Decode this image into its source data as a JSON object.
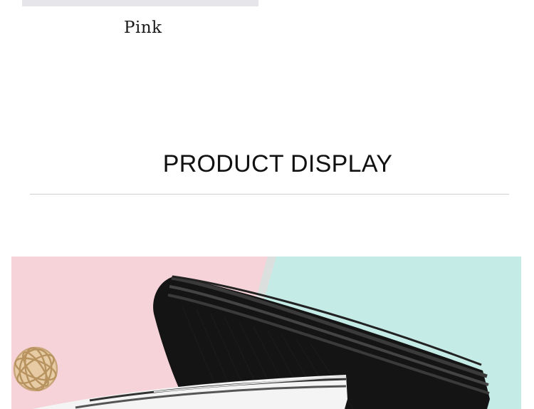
{
  "previous_variant": {
    "caption": "Pink"
  },
  "section": {
    "title": "PRODUCT DISPLAY"
  },
  "photo": {
    "subject": "product-photo",
    "colors": {
      "pink_backdrop": "#f5d3d8",
      "mint_backdrop": "#c5ebe6",
      "black_fabric": "#141414",
      "white_fabric": "#f4f4f4",
      "twine_ball": "#c9a57a"
    }
  }
}
